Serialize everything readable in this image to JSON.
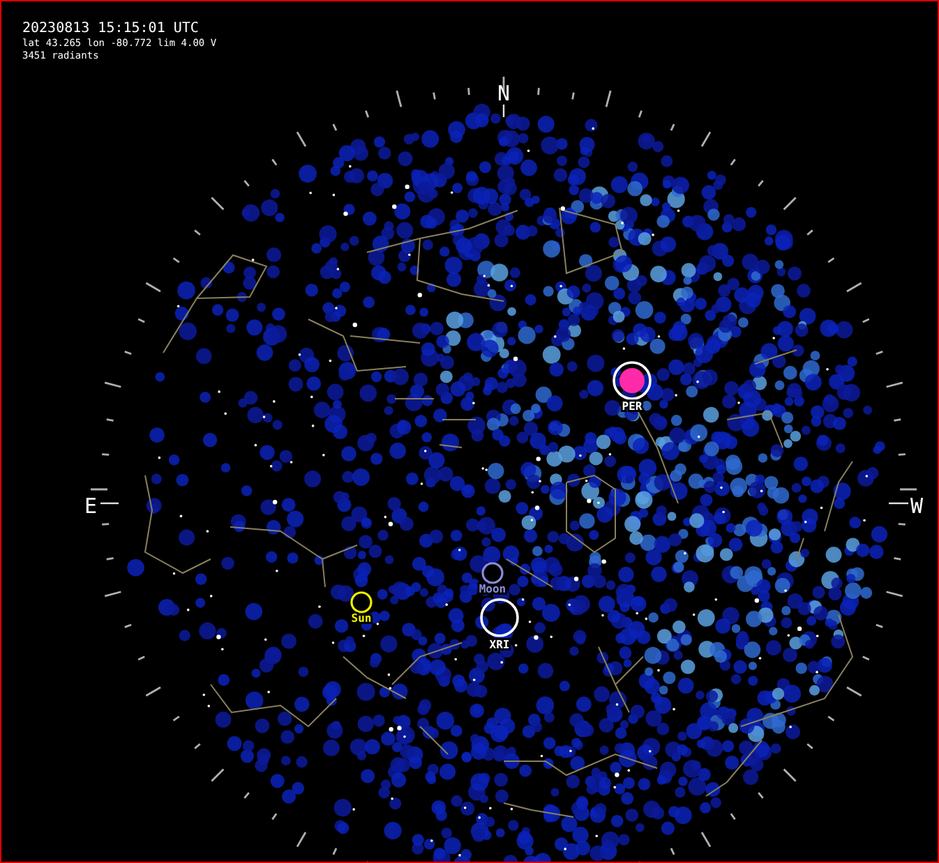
{
  "header": {
    "datetime": "20230813 15:15:01 UTC",
    "location": "lat 43.265 lon -80.772 lim 4.00 V",
    "count": "3451 radiants"
  },
  "compass": [
    {
      "label": "N",
      "kind": "north"
    },
    {
      "label": "E",
      "kind": "east"
    },
    {
      "label": "W",
      "kind": "west"
    }
  ],
  "markers": [
    {
      "label": "PER",
      "kind": "radiant",
      "color": "#ffffff"
    },
    {
      "label": "Moon",
      "kind": "moon",
      "color": "#8c8cd8"
    },
    {
      "label": "Sun",
      "kind": "sun",
      "color": "#f0f000"
    },
    {
      "label": "XRI",
      "kind": "radiant",
      "color": "#ffffff"
    }
  ]
}
